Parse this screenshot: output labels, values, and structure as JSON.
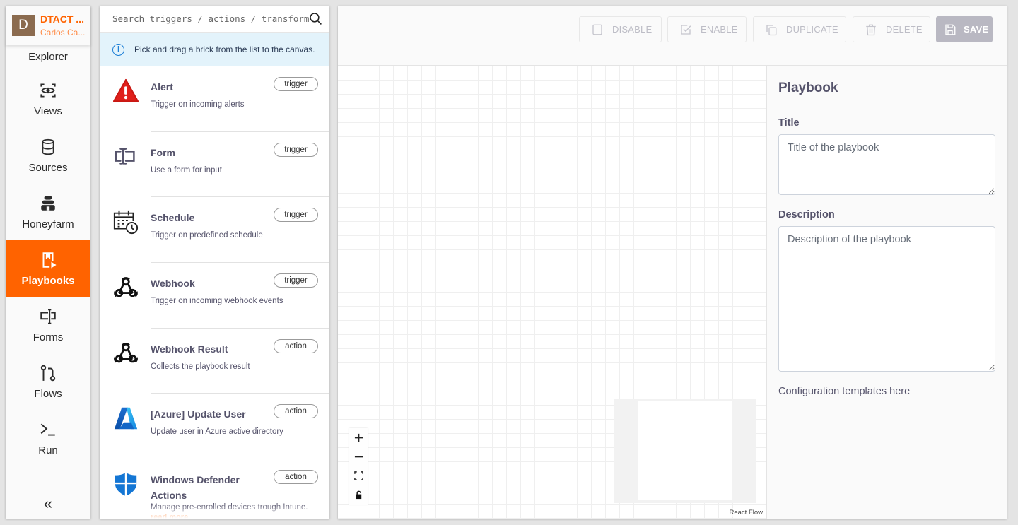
{
  "brand": {
    "initial": "D",
    "name": "DTACT ...",
    "user": "Carlos Ca..."
  },
  "nav": {
    "items": [
      {
        "id": "explorer",
        "label": "Explorer",
        "icon": "explorer"
      },
      {
        "id": "views",
        "label": "Views",
        "icon": "eye-icon"
      },
      {
        "id": "sources",
        "label": "Sources",
        "icon": "database-icon"
      },
      {
        "id": "honeyfarm",
        "label": "Honeyfarm",
        "icon": "honeyfarm-icon"
      },
      {
        "id": "playbooks",
        "label": "Playbooks",
        "icon": "playbook-icon",
        "active": true
      },
      {
        "id": "forms",
        "label": "Forms",
        "icon": "form-icon"
      },
      {
        "id": "flows",
        "label": "Flows",
        "icon": "flow-icon"
      },
      {
        "id": "run",
        "label": "Run",
        "icon": "terminal-icon"
      }
    ],
    "collapse_label": "«"
  },
  "bricks": {
    "search_placeholder": "Search triggers / actions / transforms",
    "info": "Pick and drag a brick from the list to the canvas.",
    "items": [
      {
        "name": "Alert",
        "desc": "Trigger on incoming alerts",
        "tag": "trigger",
        "icon": "alert-icon"
      },
      {
        "name": "Form",
        "desc": "Use a form for input",
        "tag": "trigger",
        "icon": "form-icon"
      },
      {
        "name": "Schedule",
        "desc": "Trigger on predefined schedule",
        "tag": "trigger",
        "icon": "schedule-icon"
      },
      {
        "name": "Webhook",
        "desc": "Trigger on incoming webhook events",
        "tag": "trigger",
        "icon": "webhook-icon"
      },
      {
        "name": "Webhook Result",
        "desc": "Collects the playbook result",
        "tag": "action",
        "icon": "webhook-icon"
      },
      {
        "name": "[Azure] Update User",
        "desc": "Update user in Azure active directory",
        "tag": "action",
        "icon": "azure-icon"
      },
      {
        "name": "Windows Defender Actions",
        "desc": "Manage pre-enrolled devices trough Intune.",
        "tag": "action",
        "icon": "defender-icon",
        "more": "read more"
      }
    ]
  },
  "toolbar": {
    "disable": "DISABLE",
    "enable": "ENABLE",
    "duplicate": "DUPLICATE",
    "delete": "DELETE",
    "save": "SAVE"
  },
  "canvas": {
    "attribution": "React Flow"
  },
  "props": {
    "heading": "Playbook",
    "title_label": "Title",
    "title_placeholder": "Title of the playbook",
    "description_label": "Description",
    "description_placeholder": "Description of the playbook",
    "config_text": "Configuration templates here"
  },
  "colors": {
    "accent": "#ff6300",
    "info_bg": "#e3f3fb",
    "save_disabled": "#b9b8c2"
  }
}
